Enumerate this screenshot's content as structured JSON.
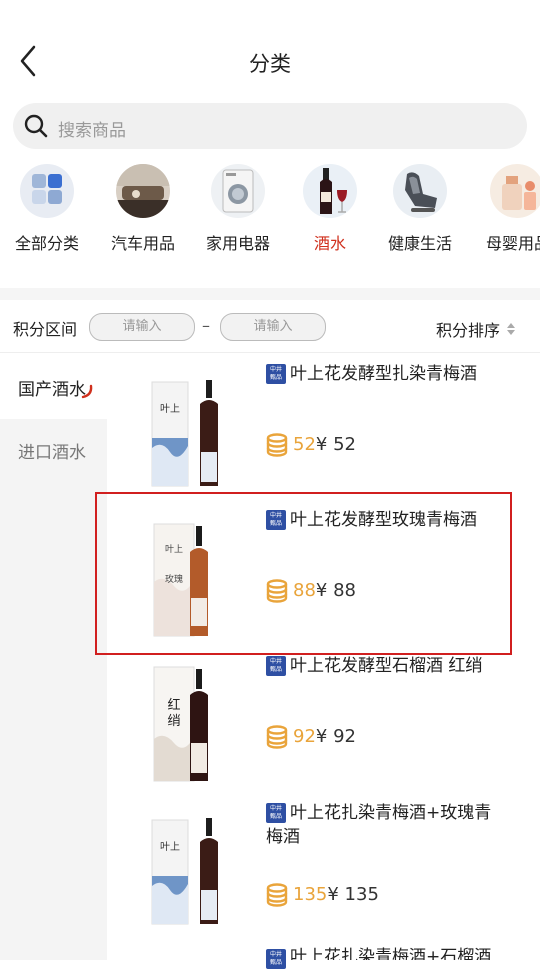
{
  "header": {
    "title": "分类"
  },
  "search": {
    "placeholder": "搜索商品"
  },
  "categories": [
    {
      "label": "全部分类"
    },
    {
      "label": "汽车用品"
    },
    {
      "label": "家用电器"
    },
    {
      "label": "酒水",
      "active": true
    },
    {
      "label": "健康生活"
    },
    {
      "label": "母婴用品"
    }
  ],
  "filter": {
    "label": "积分区间",
    "min_placeholder": "请输入",
    "separator": "–",
    "max_placeholder": "请输入",
    "sort_label": "积分排序"
  },
  "sidebar": {
    "items": [
      {
        "label": "国产酒水",
        "selected": true
      },
      {
        "label": "进口酒水",
        "selected": false
      }
    ]
  },
  "badge_text": {
    "line1": "中井",
    "line2": "甄品"
  },
  "products": [
    {
      "name": "叶上花发酵型扎染青梅酒",
      "points": "52",
      "price": "¥ 52"
    },
    {
      "name": "叶上花发酵型玫瑰青梅酒",
      "points": "88",
      "price": "¥ 88"
    },
    {
      "name": "叶上花发酵型石榴酒 红绡",
      "points": "92",
      "price": "¥ 92"
    },
    {
      "name": "叶上花扎染青梅酒+玫瑰青梅酒",
      "points": "135",
      "price": "¥ 135"
    },
    {
      "name": "叶上花扎染青梅酒+石榴酒"
    }
  ],
  "colors": {
    "accent": "#d0301d",
    "points": "#e9a43b",
    "badge": "#2e4fa3",
    "highlight": "#d11f1f"
  }
}
